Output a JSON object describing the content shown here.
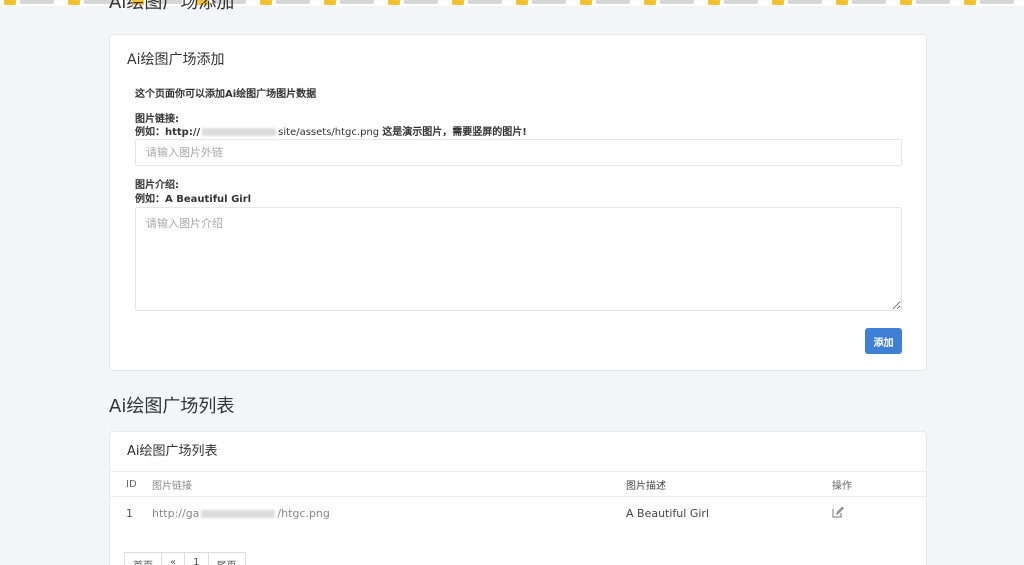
{
  "top_section_title": "Ai绘图广场添加",
  "add_card": {
    "header": "Ai绘图广场添加",
    "description": "这个页面你可以添加Ai绘图广场图片数据",
    "url_label": "图片链接:",
    "url_example_prefix": "例如：http://",
    "url_example_suffix": "site/assets/htgc.png",
    "url_example_note": "这是演示图片，需要竖屏的图片!",
    "url_placeholder": "请输入图片外链",
    "intro_label": "图片介绍:",
    "intro_example": "例如：A Beautiful Girl",
    "intro_placeholder": "请输入图片介绍",
    "add_button": "添加"
  },
  "list_section_title": "Ai绘图广场列表",
  "list_card": {
    "header": "Ai绘图广场列表",
    "columns": [
      "ID",
      "图片链接",
      "图片描述",
      "操作"
    ],
    "rows": [
      {
        "id": "1",
        "url_prefix": "http://ga",
        "url_suffix": "/htgc.png",
        "desc": "A Beautiful Girl"
      }
    ]
  },
  "pagination": [
    "首页",
    "«",
    "1",
    "尾页"
  ],
  "accent_color": "#3f7fd6"
}
